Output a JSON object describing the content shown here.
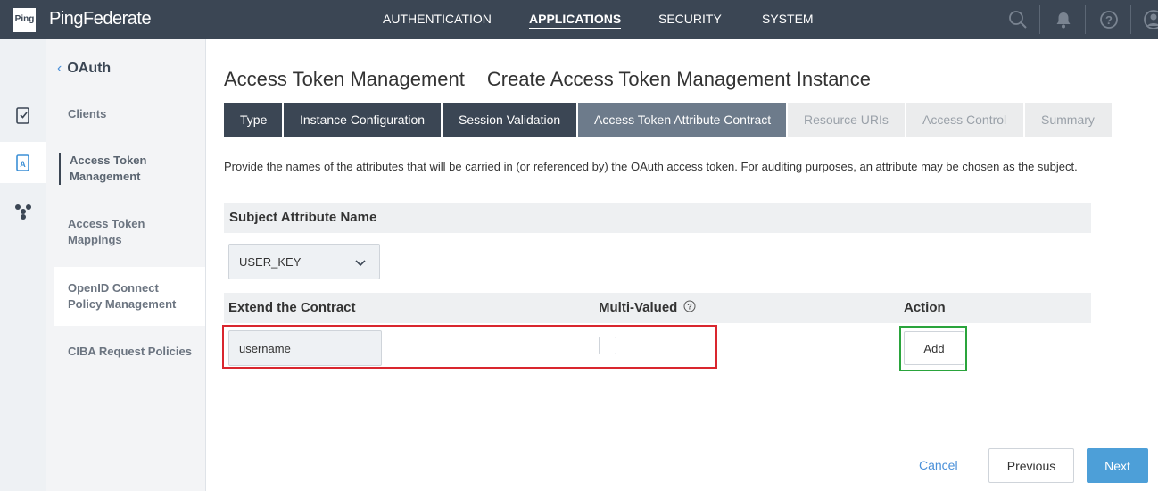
{
  "brand": {
    "logo_text": "Ping",
    "name": "PingFederate"
  },
  "topnav": [
    {
      "label": "AUTHENTICATION",
      "active": false
    },
    {
      "label": "APPLICATIONS",
      "active": true
    },
    {
      "label": "SECURITY",
      "active": false
    },
    {
      "label": "SYSTEM",
      "active": false
    }
  ],
  "top_icons": [
    "search-icon",
    "bell-icon",
    "help-icon",
    "user-icon"
  ],
  "rail_icons": [
    "applications-icon",
    "oauth-icon",
    "oauth-shield-icon"
  ],
  "subnav": {
    "back_label": "OAuth",
    "items": [
      {
        "label": "Clients",
        "active": false
      },
      {
        "label": "Access Token Management",
        "active": true
      },
      {
        "label": "Access Token Mappings",
        "active": false
      },
      {
        "label": "OpenID Connect Policy Management",
        "active": false
      },
      {
        "label": "CIBA Request Policies",
        "active": false
      }
    ]
  },
  "page": {
    "title_left": "Access Token Management",
    "title_right": "Create Access Token Management Instance",
    "description": "Provide the names of the attributes that will be carried in (or referenced by) the OAuth access token. For auditing purposes, an attribute may be chosen as the subject."
  },
  "tabs": [
    {
      "label": "Type",
      "state": "done"
    },
    {
      "label": "Instance Configuration",
      "state": "done"
    },
    {
      "label": "Session Validation",
      "state": "done"
    },
    {
      "label": "Access Token Attribute Contract",
      "state": "current"
    },
    {
      "label": "Resource URIs",
      "state": "todo"
    },
    {
      "label": "Access Control",
      "state": "todo"
    },
    {
      "label": "Summary",
      "state": "todo"
    }
  ],
  "subject": {
    "header": "Subject Attribute Name",
    "selected": "USER_KEY"
  },
  "contract": {
    "col_extend": "Extend the Contract",
    "col_multi": "Multi-Valued",
    "col_action": "Action",
    "input_value": "username",
    "multi_checked": false,
    "add_label": "Add"
  },
  "footer": {
    "cancel_label": "Cancel",
    "previous_label": "Previous",
    "next_label": "Next"
  },
  "colors": {
    "topbar": "#3b4654",
    "accent": "#4d9fd8",
    "highlight_red": "#d9262e",
    "highlight_green": "#2aa43c"
  }
}
